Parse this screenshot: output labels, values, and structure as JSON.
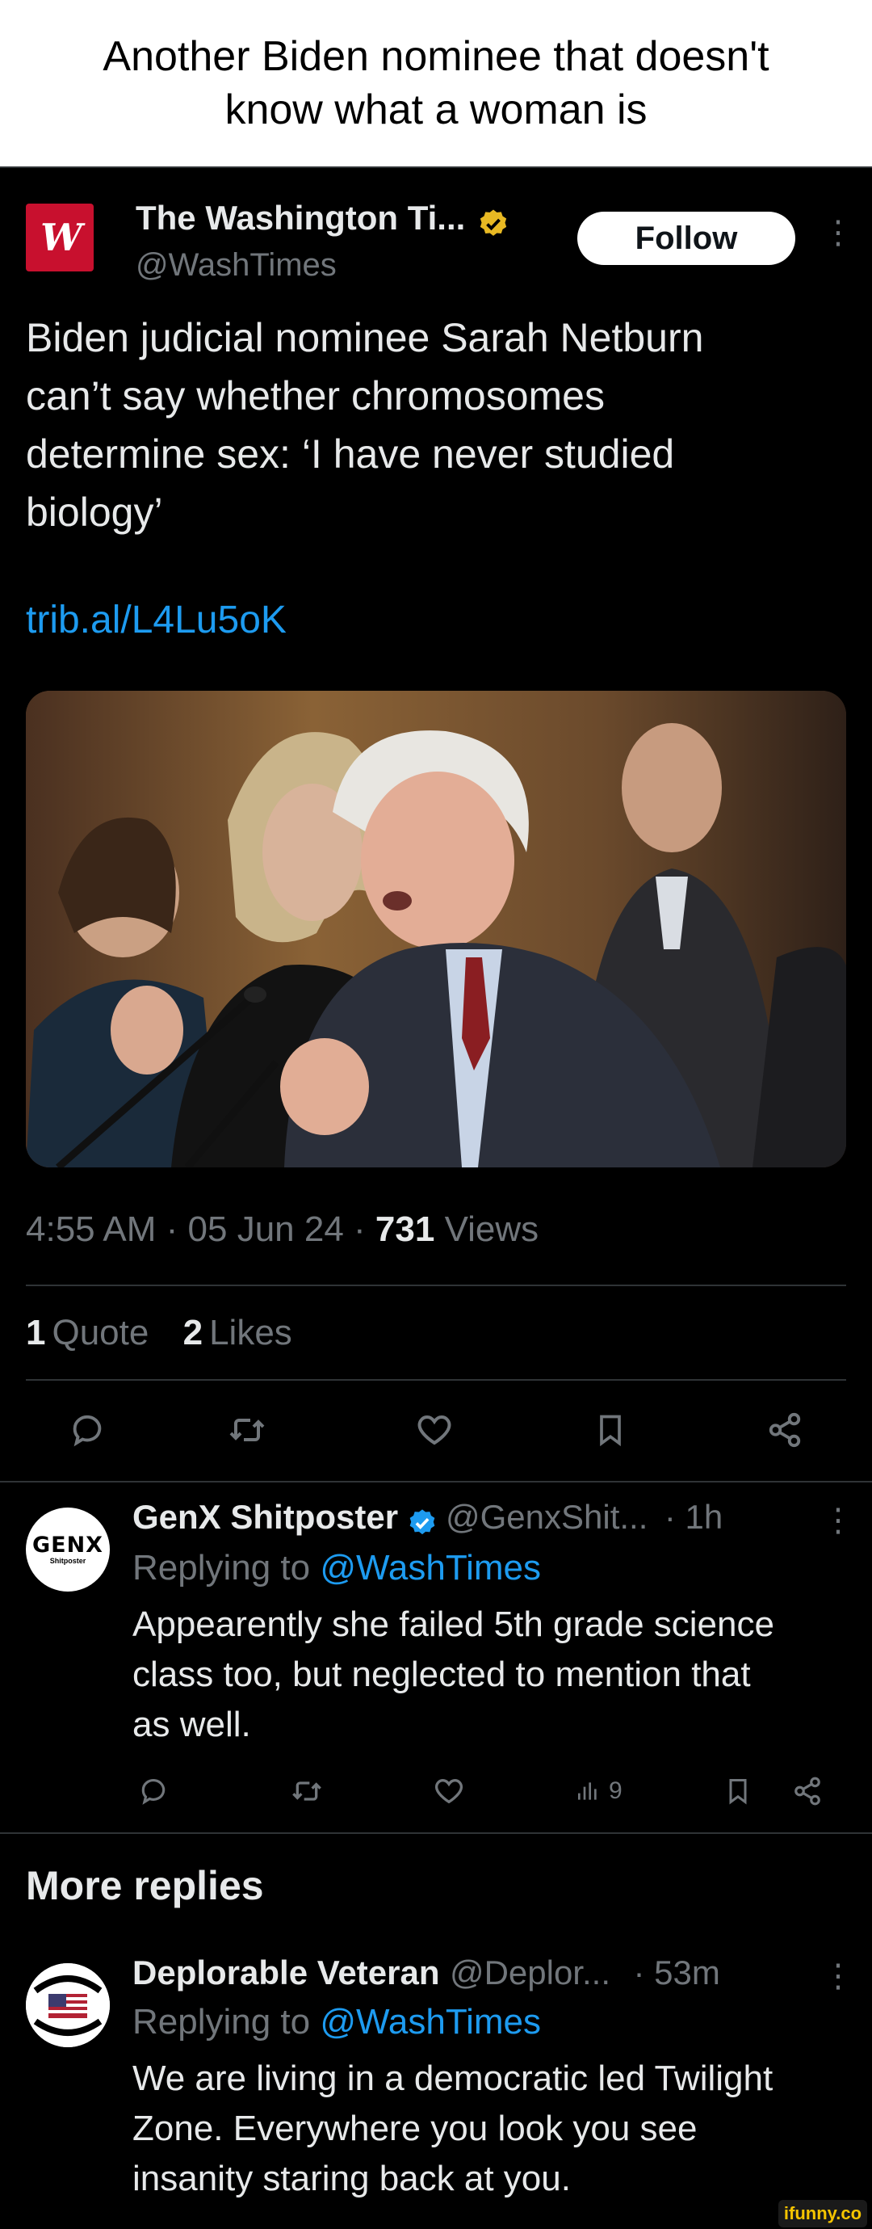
{
  "caption": {
    "line1": "Another Biden nominee that doesn't",
    "line2": "know what a woman is"
  },
  "tweet": {
    "avatar_letters": "W",
    "name": "The Washington Ti...",
    "handle": "@WashTimes",
    "follow_label": "Follow",
    "text_lines": [
      "Biden judicial nominee Sarah Netburn",
      "can’t say whether chromosomes",
      "determine sex: ‘I have never studied",
      "biology’"
    ],
    "link": "trib.al/L4Lu5oK",
    "time": "4:55 AM · 05 Jun 24 · ",
    "views_count": "731",
    "views_label": " Views",
    "quotes_count": "1",
    "quotes_label": "Quote",
    "likes_count": "2",
    "likes_label": "Likes"
  },
  "replies": [
    {
      "avatar_line1": "GENX",
      "avatar_line2": "Shitposter",
      "name": "GenX Shitposter",
      "handle": "@GenxShit...",
      "time": "· 1h",
      "replying_prefix": "Replying to ",
      "replying_to": "@WashTimes",
      "text_lines": [
        "Appearently she failed 5th grade science",
        "class too, but neglected to mention that",
        "as well."
      ],
      "views": "9"
    },
    {
      "name": "Deplorable Veteran",
      "handle": "@Deplor...",
      "time": "· 53m",
      "replying_prefix": "Replying to ",
      "replying_to": "@WashTimes",
      "text_lines": [
        "We are living in a democratic led Twilight",
        "Zone.  Everywhere you look you see",
        "insanity staring back at you."
      ]
    }
  ],
  "more_replies_label": "More replies",
  "watermark": "ifunny.co",
  "colors": {
    "background": "#000000",
    "text": "#e7e9ea",
    "muted": "#71767b",
    "link": "#1d9bf0",
    "verified_gold": "#e8b923",
    "verified_blue": "#1d9bf0",
    "brand_red": "#c8102e"
  }
}
